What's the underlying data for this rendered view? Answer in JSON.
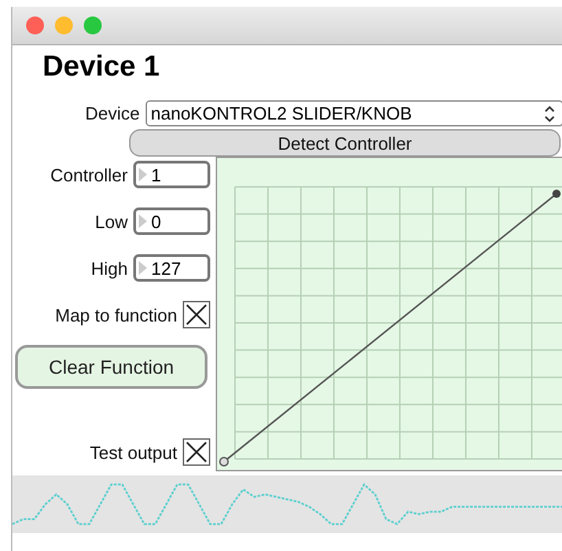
{
  "window": {
    "title": "Device 1"
  },
  "device": {
    "label": "Device",
    "value": "nanoKONTROL2 SLIDER/KNOB"
  },
  "detect_button": "Detect Controller",
  "fields": [
    {
      "label": "Controller",
      "value": "1"
    },
    {
      "label": "Low",
      "value": "0"
    },
    {
      "label": "High",
      "value": "127"
    }
  ],
  "map_to_function": {
    "label": "Map to function",
    "checked": true
  },
  "clear_button": "Clear Function",
  "test_output": {
    "label": "Test output",
    "checked": true
  }
}
